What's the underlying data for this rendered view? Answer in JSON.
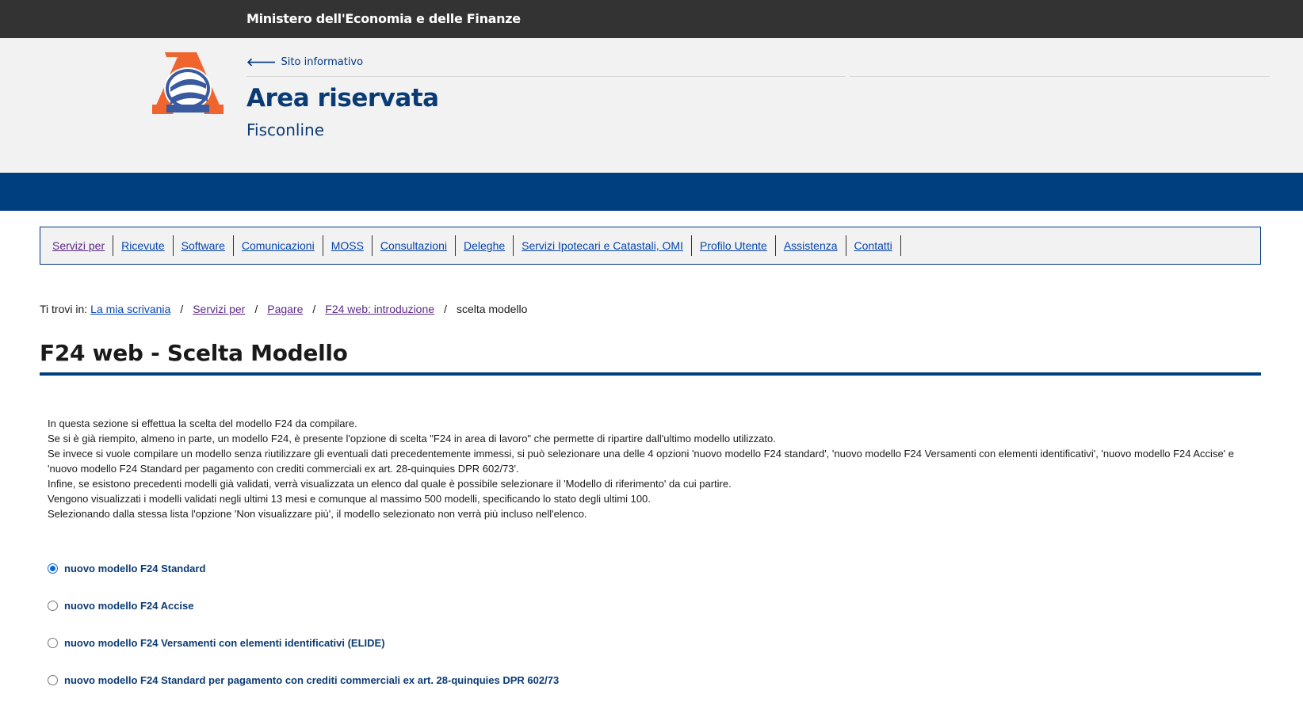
{
  "topbar": {
    "ministry": "Ministero dell'Economia e delle Finanze"
  },
  "header": {
    "back_link": "Sito informativo",
    "title": "Area riservata",
    "subtitle": "Fisconline"
  },
  "nav": {
    "items": [
      {
        "label": "Servizi per",
        "visited": true
      },
      {
        "label": "Ricevute"
      },
      {
        "label": "Software"
      },
      {
        "label": "Comunicazioni"
      },
      {
        "label": "MOSS"
      },
      {
        "label": "Consultazioni"
      },
      {
        "label": "Deleghe"
      },
      {
        "label": "Servizi Ipotecari e Catastali, OMI"
      },
      {
        "label": "Profilo Utente"
      },
      {
        "label": "Assistenza"
      },
      {
        "label": "Contatti"
      }
    ]
  },
  "breadcrumb": {
    "prefix": "Ti trovi in:",
    "items": [
      "La mia scrivania",
      "Servizi per",
      "Pagare",
      "F24 web: introduzione"
    ],
    "current": "scelta modello",
    "separator": "/"
  },
  "page": {
    "title": "F24 web - Scelta Modello"
  },
  "intro": {
    "lines": [
      "In questa sezione si effettua la scelta del modello F24 da compilare.",
      "Se si è già riempito, almeno in parte, un modello F24, è presente l'opzione di scelta \"F24 in area di lavoro\" che permette di ripartire dall'ultimo modello utilizzato.",
      "Se invece si vuole compilare un modello senza riutilizzare gli eventuali dati precedentemente immessi, si può selezionare una delle 4 opzioni 'nuovo modello F24 standard', 'nuovo modello F24 Versamenti con elementi identificativi', 'nuovo modello F24 Accise' e 'nuovo modello F24 Standard per pagamento con crediti commerciali ex art. 28-quinquies DPR 602/73'.",
      "Infine, se esistono precedenti modelli già validati, verrà visualizzata un elenco dal quale è possibile selezionare il 'Modello di riferimento' da cui partire.",
      "Vengono visualizzati i modelli validati negli ultimi 13 mesi e comunque al massimo 500 modelli, specificando lo stato degli ultimi 100.",
      "Selezionando dalla stessa lista l'opzione 'Non visualizzare più', il modello selezionato non verrà più incluso nell'elenco."
    ]
  },
  "options": [
    {
      "label": "nuovo modello F24 Standard",
      "checked": true
    },
    {
      "label": "nuovo modello F24 Accise",
      "checked": false
    },
    {
      "label": "nuovo modello F24 Versamenti con elementi identificativi (ELIDE)",
      "checked": false
    },
    {
      "label": "nuovo modello F24 Standard per pagamento con crediti commerciali ex art. 28-quinquies DPR 602/73",
      "checked": false
    }
  ],
  "colors": {
    "topbar": "#333333",
    "header_bg": "#f2f2f2",
    "brand_blue": "#003f7f",
    "title_blue": "#0b3b74",
    "link": "#0645ad",
    "visited_link": "#5b2a86",
    "logo_orange": "#f0642d"
  },
  "icons": {
    "logo": "agenzia-entrate-logo",
    "back": "arrow-left-icon"
  }
}
